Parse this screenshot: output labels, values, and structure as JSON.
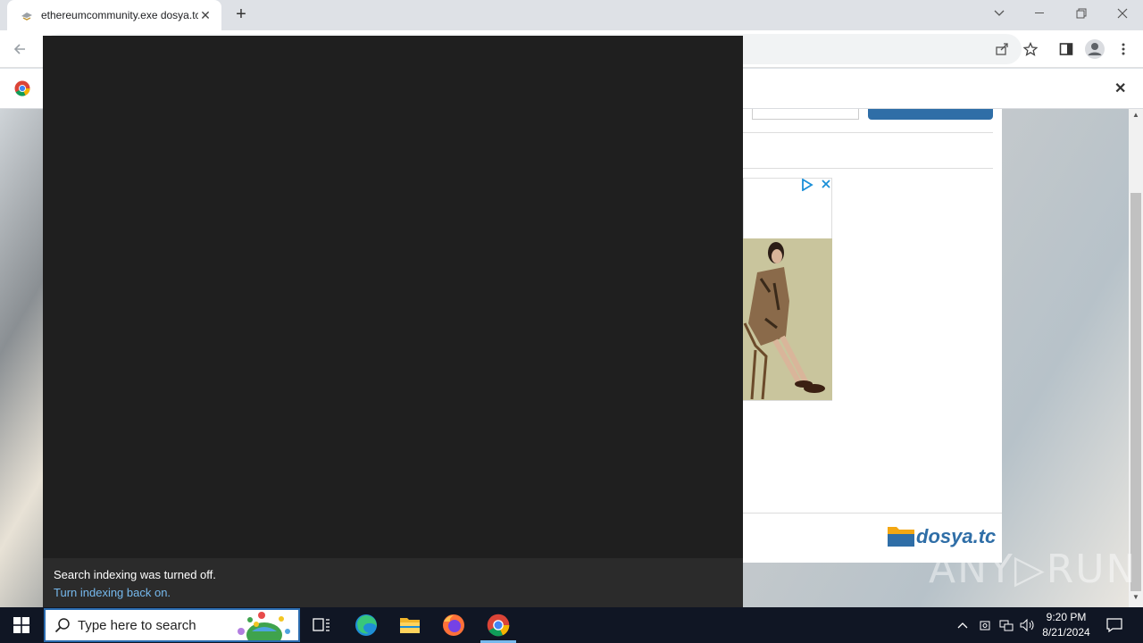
{
  "browser": {
    "tab": {
      "title": "ethereumcommunity.exe dosya.tc"
    },
    "toolbar": {
      "back_icon": "back-arrow-icon",
      "share_icon": "share-icon",
      "bookmark_icon": "star-icon",
      "sidepanel_icon": "side-panel-icon",
      "profile_icon": "profile-icon",
      "menu_icon": "kebab-menu-icon"
    },
    "infobar": {
      "close_label": "✕"
    }
  },
  "webpage": {
    "brand": "dosya.tc"
  },
  "search_panel": {
    "message": "Search indexing was turned off.",
    "link": "Turn indexing back on."
  },
  "watermark": "ANY▷RUN",
  "taskbar": {
    "search_placeholder": "Type here to search",
    "time": "9:20 PM",
    "date": "8/21/2024",
    "accent": "#76b9ed"
  }
}
